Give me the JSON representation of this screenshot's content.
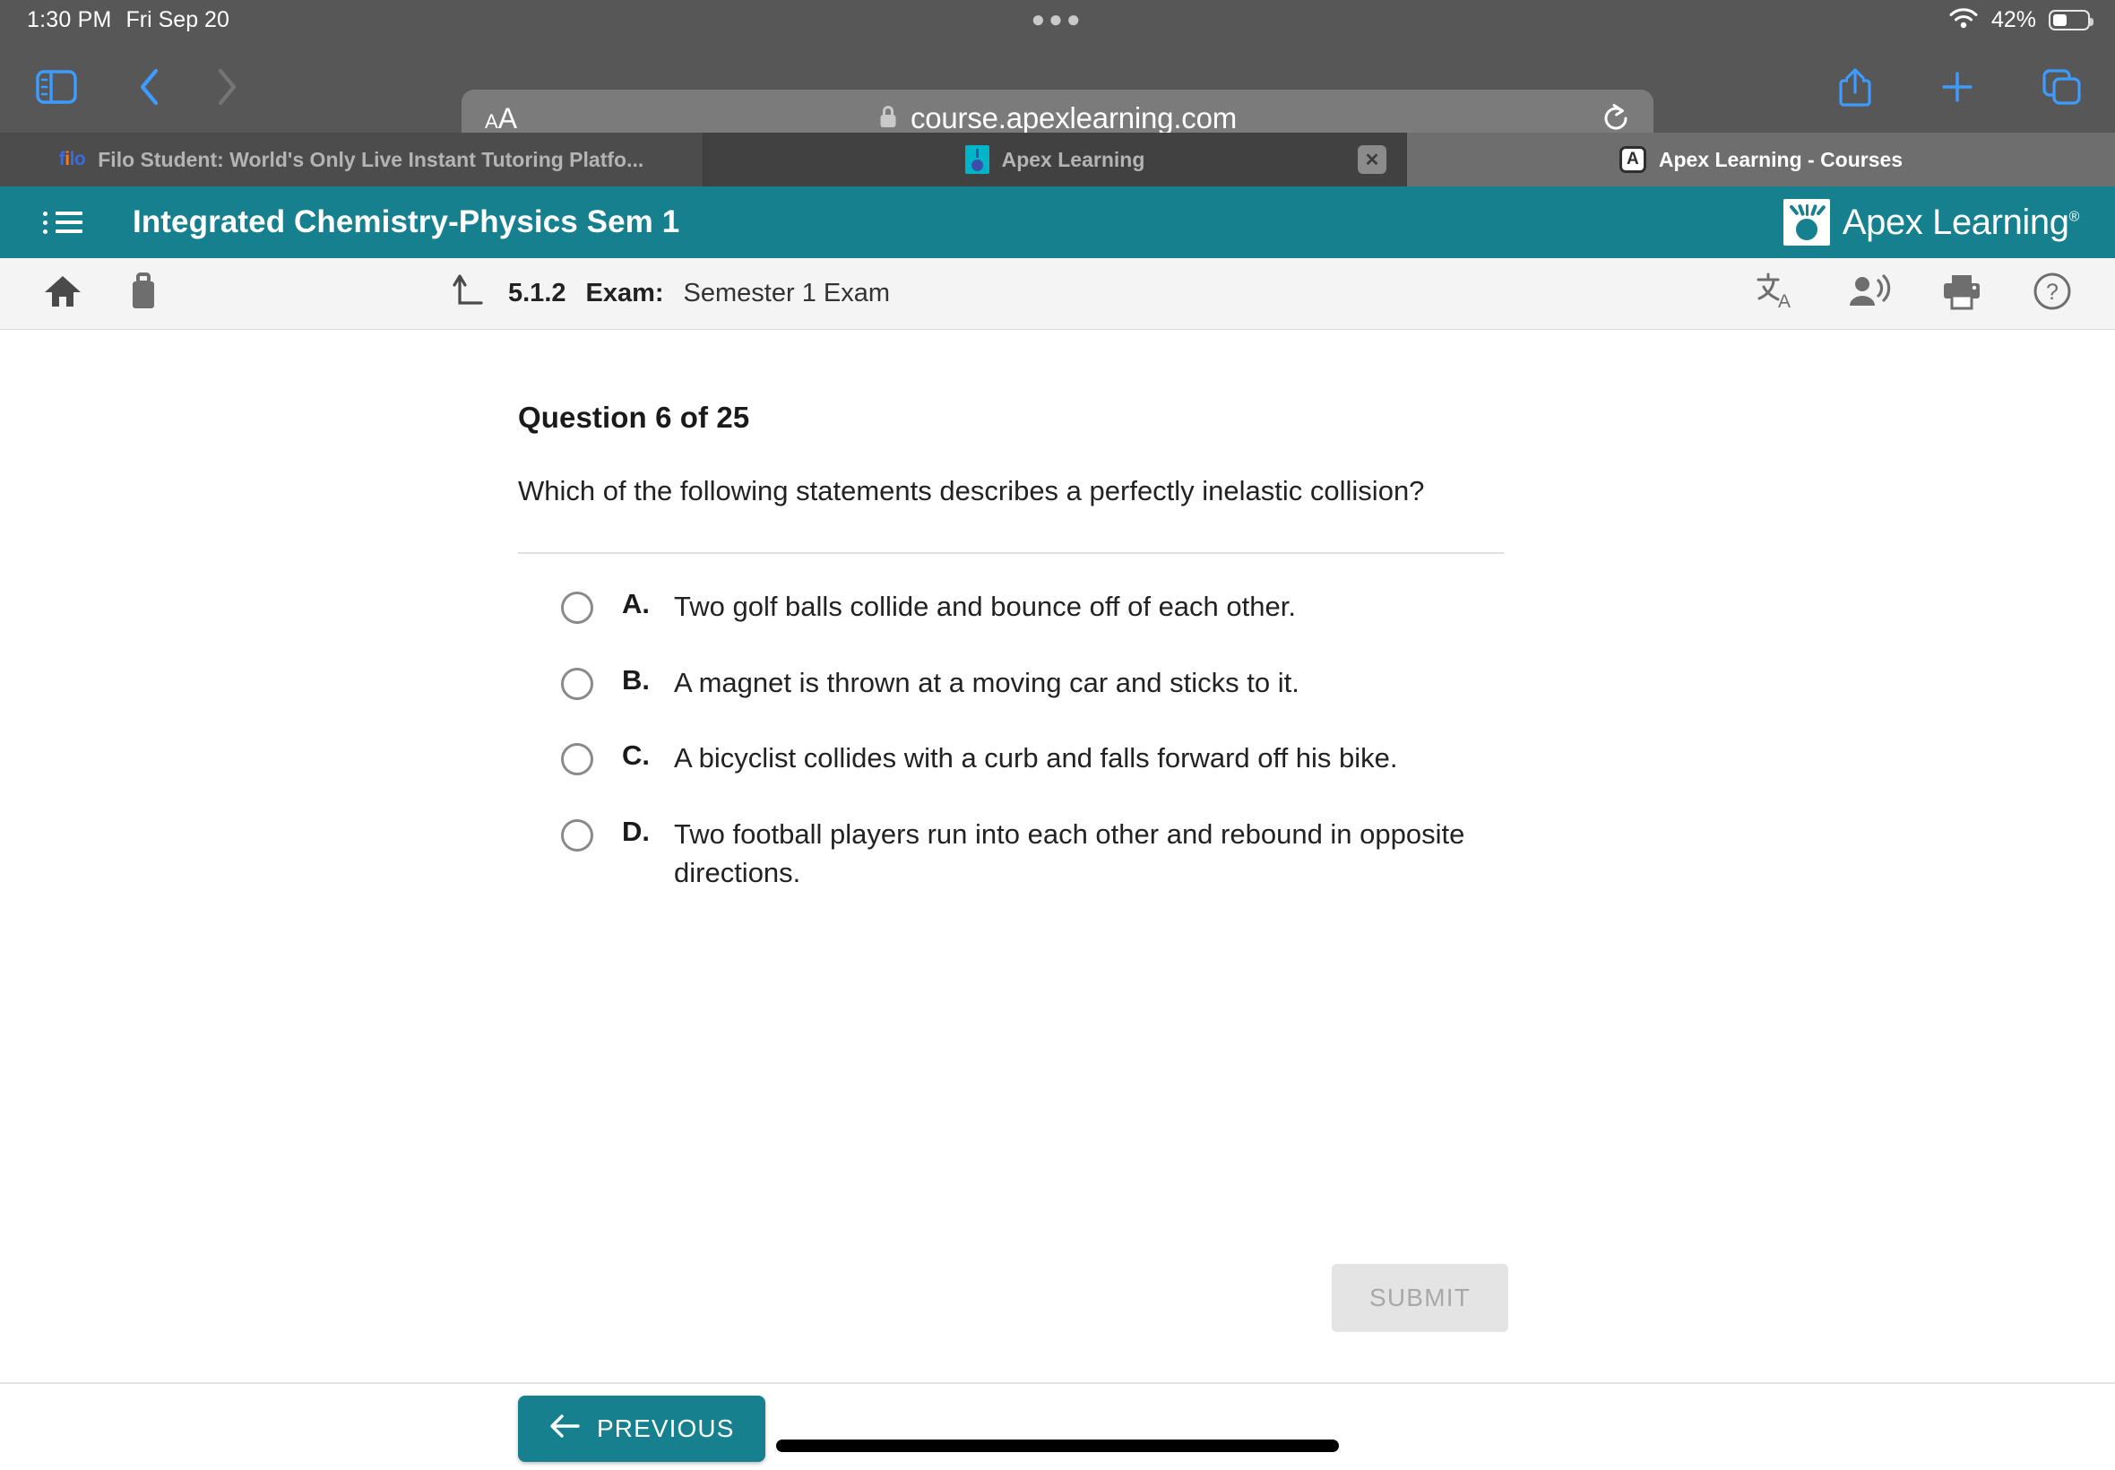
{
  "status_bar": {
    "time": "1:30 PM",
    "date": "Fri Sep 20",
    "battery_percent": "42%",
    "wifi_icon": "wifi-icon",
    "battery_icon": "battery-icon"
  },
  "browser": {
    "sidebar_icon": "sidebar-icon",
    "back_icon": "chevron-left-icon",
    "forward_icon": "chevron-right-icon",
    "text_size_small": "A",
    "text_size_large": "A",
    "lock_icon": "lock-icon",
    "url": "course.apexlearning.com",
    "reload_icon": "reload-icon",
    "share_icon": "share-icon",
    "new_tab_icon": "plus-icon",
    "tabs_overview_icon": "tabs-overview-icon",
    "tabs": [
      {
        "title": "Filo Student: World's Only Live Instant Tutoring Platfo...",
        "favicon": "filo-favicon",
        "active": false,
        "has_close": false
      },
      {
        "title": "Apex Learning",
        "favicon": "apex-bulb-favicon",
        "active": false,
        "has_close": true,
        "close_label": "✕"
      },
      {
        "title": "Apex Learning - Courses",
        "favicon": "apex-a-favicon",
        "favicon_letter": "A",
        "active": true,
        "has_close": false
      }
    ]
  },
  "course_header": {
    "menu_icon": "list-menu-icon",
    "title": "Integrated Chemistry-Physics Sem 1",
    "brand_name": "Apex Learning",
    "brand_trademark": "®",
    "brand_icon": "apex-lightbulb-logo",
    "background_color": "#16808f"
  },
  "toolbar": {
    "home_icon": "home-icon",
    "briefcase_icon": "briefcase-icon",
    "level_up_icon": "level-up-arrow-icon",
    "activity_code": "5.1.2",
    "activity_kind": "Exam:",
    "activity_name": "Semester 1 Exam",
    "translate_icon": "translate-icon",
    "read_aloud_icon": "read-aloud-icon",
    "print_icon": "print-icon",
    "help_icon": "help-circle-icon"
  },
  "question": {
    "heading": "Question 6 of 25",
    "prompt": "Which of the following statements describes a perfectly inelastic collision?",
    "options": [
      {
        "letter": "A.",
        "text": "Two golf balls collide and bounce off of each other.",
        "selected": false
      },
      {
        "letter": "B.",
        "text": "A magnet is thrown at a moving car and sticks to it.",
        "selected": false
      },
      {
        "letter": "C.",
        "text": "A bicyclist collides with a curb and falls forward off his bike.",
        "selected": false
      },
      {
        "letter": "D.",
        "text": "Two football players run into each other and rebound in opposite directions.",
        "selected": false
      }
    ],
    "submit_label": "SUBMIT",
    "submit_enabled": false
  },
  "footer": {
    "previous_label": "PREVIOUS",
    "previous_icon": "arrow-left-icon",
    "home_indicator": "home-indicator"
  }
}
